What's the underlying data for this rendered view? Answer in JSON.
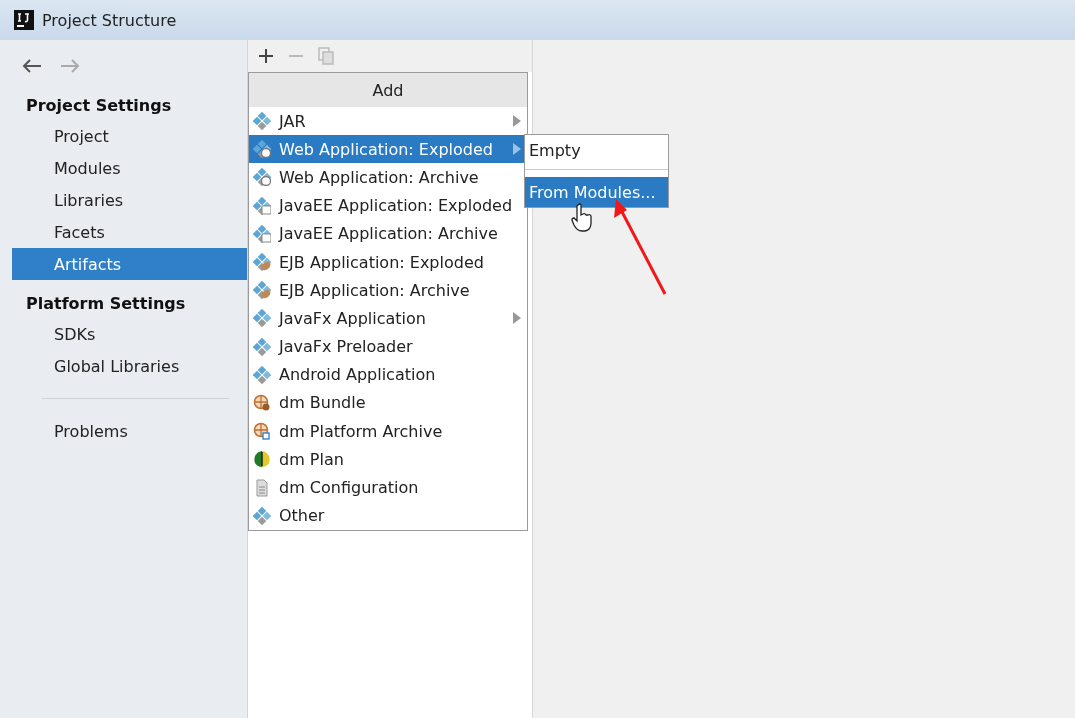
{
  "window": {
    "title": "Project Structure"
  },
  "sidebar": {
    "sections": [
      {
        "title": "Project Settings",
        "items": [
          {
            "label": "Project",
            "selected": false
          },
          {
            "label": "Modules",
            "selected": false
          },
          {
            "label": "Libraries",
            "selected": false
          },
          {
            "label": "Facets",
            "selected": false
          },
          {
            "label": "Artifacts",
            "selected": true
          }
        ]
      },
      {
        "title": "Platform Settings",
        "items": [
          {
            "label": "SDKs",
            "selected": false
          },
          {
            "label": "Global Libraries",
            "selected": false
          }
        ]
      }
    ],
    "footer_items": [
      {
        "label": "Problems",
        "selected": false
      }
    ]
  },
  "add_menu": {
    "title": "Add",
    "items": [
      {
        "label": "JAR",
        "kind": "artifact",
        "has_submenu": true,
        "selected": false
      },
      {
        "label": "Web Application: Exploded",
        "kind": "web",
        "has_submenu": true,
        "selected": true
      },
      {
        "label": "Web Application: Archive",
        "kind": "web",
        "has_submenu": false,
        "selected": false
      },
      {
        "label": "JavaEE Application: Exploded",
        "kind": "javaee",
        "has_submenu": false,
        "selected": false
      },
      {
        "label": "JavaEE Application: Archive",
        "kind": "javaee",
        "has_submenu": false,
        "selected": false
      },
      {
        "label": "EJB Application: Exploded",
        "kind": "ejb",
        "has_submenu": false,
        "selected": false
      },
      {
        "label": "EJB Application: Archive",
        "kind": "ejb",
        "has_submenu": false,
        "selected": false
      },
      {
        "label": "JavaFx Application",
        "kind": "artifact",
        "has_submenu": true,
        "selected": false
      },
      {
        "label": "JavaFx Preloader",
        "kind": "artifact",
        "has_submenu": false,
        "selected": false
      },
      {
        "label": "Android Application",
        "kind": "artifact",
        "has_submenu": false,
        "selected": false
      },
      {
        "label": "dm Bundle",
        "kind": "bundle",
        "has_submenu": false,
        "selected": false
      },
      {
        "label": "dm Platform Archive",
        "kind": "platform",
        "has_submenu": false,
        "selected": false
      },
      {
        "label": "dm Plan",
        "kind": "plan",
        "has_submenu": false,
        "selected": false
      },
      {
        "label": "dm Configuration",
        "kind": "config",
        "has_submenu": false,
        "selected": false
      },
      {
        "label": "Other",
        "kind": "artifact",
        "has_submenu": false,
        "selected": false
      }
    ]
  },
  "submenu": {
    "items": [
      {
        "label": "Empty",
        "selected": false
      },
      {
        "label": "From Modules...",
        "selected": true
      }
    ]
  }
}
